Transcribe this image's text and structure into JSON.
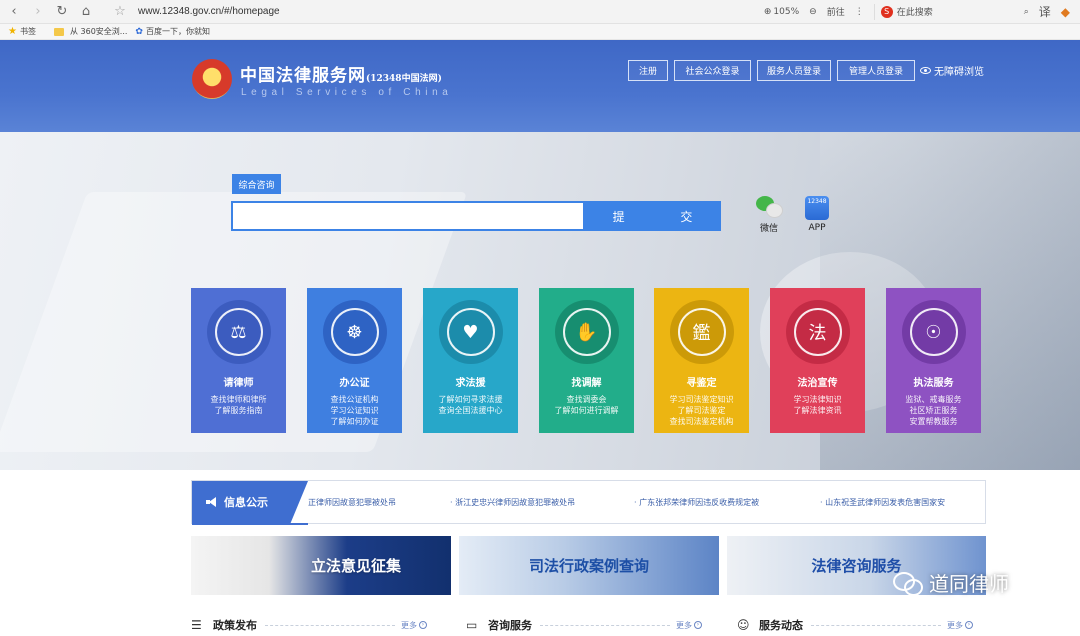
{
  "browser": {
    "url": "www.12348.gov.cn/#/homepage",
    "zoom": "105%",
    "forward_label": "前往",
    "search_placeholder": "在此搜索",
    "translate_label": "译"
  },
  "bookmarks": [
    {
      "label": "书签"
    },
    {
      "label": "从 360安全浏..."
    },
    {
      "label": "百度一下，你就知"
    }
  ],
  "header": {
    "title": "中国法律服务网",
    "title_suffix": "(12348中国法网)",
    "subtitle_en": "Legal Services of China",
    "buttons": [
      "注册",
      "社会公众登录",
      "服务人员登录",
      "管理人员登录"
    ],
    "accessibility": "无障碍浏览"
  },
  "search": {
    "tab": "综合咨询",
    "input_value": "",
    "submit": "提  交",
    "wechat_label": "微信",
    "app_label": "APP",
    "app_icon_text": "12348"
  },
  "services": [
    {
      "title": "请律师",
      "desc": "查找律师和律所\n了解服务指南",
      "color": "#4f6fd4",
      "ring": "#3c5cbf",
      "glyph": "⚖"
    },
    {
      "title": "办公证",
      "desc": "查找公证机构\n学习公证知识\n了解如何办证",
      "color": "#3f7fe0",
      "ring": "#2e63c4",
      "glyph": "☸"
    },
    {
      "title": "求法援",
      "desc": "了解如何寻求法援\n查询全国法援中心",
      "color": "#27a7c9",
      "ring": "#1c8cab",
      "glyph": "♥"
    },
    {
      "title": "找调解",
      "desc": "查找调委会\n了解如何进行调解",
      "color": "#22ad8a",
      "ring": "#178e70",
      "glyph": "✋"
    },
    {
      "title": "寻鉴定",
      "desc": "学习司法鉴定知识\n了解司法鉴定\n查找司法鉴定机构",
      "color": "#ecb512",
      "ring": "#cc9a08",
      "glyph": "鑑"
    },
    {
      "title": "法治宣传",
      "desc": "学习法律知识\n了解法律资讯",
      "color": "#e0405a",
      "ring": "#c42b45",
      "glyph": "法"
    },
    {
      "title": "执法服务",
      "desc": "监狱、戒毒服务\n社区矫正服务\n安置帮教服务",
      "color": "#8e52c2",
      "ring": "#733ba6",
      "glyph": "☉"
    }
  ],
  "info": {
    "title": "信息公示",
    "items": [
      "正律师因故意犯罪被处吊",
      "浙江史忠兴律师因故意犯罪被处吊",
      "广东张邦荣律师因违反收费规定被",
      "山东祝圣武律师因发表危害国家安"
    ]
  },
  "banners": [
    "立法意见征集",
    "司法行政案例查询",
    "法律咨询服务"
  ],
  "watermark": "道同律师",
  "sections": [
    {
      "title": "政策发布",
      "more": "更多"
    },
    {
      "title": "咨询服务",
      "more": "更多"
    },
    {
      "title": "服务动态",
      "more": "更多"
    }
  ]
}
